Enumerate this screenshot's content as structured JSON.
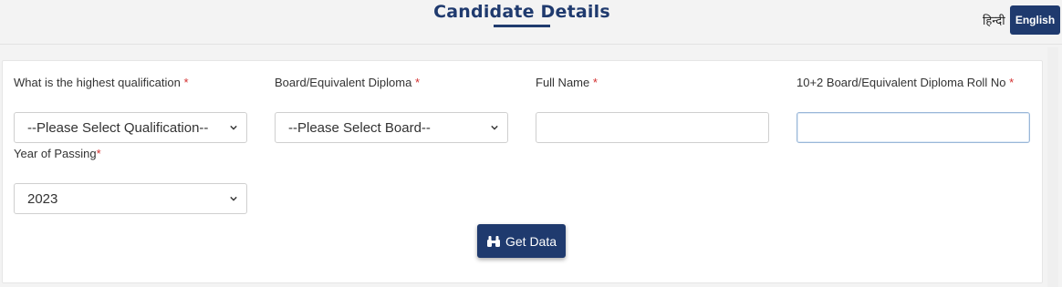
{
  "header": {
    "title": "Candidate Details",
    "lang_hindi": "हिन्दी",
    "lang_english": "English"
  },
  "form": {
    "qualification": {
      "label": "What is the highest qualification",
      "required_mark": "*",
      "value": "--Please Select Qualification--"
    },
    "board": {
      "label": "Board/Equivalent Diploma",
      "required_mark": "*",
      "value": "--Please Select Board--"
    },
    "full_name": {
      "label": "Full Name",
      "required_mark": "*",
      "value": ""
    },
    "roll_no": {
      "label": "10+2 Board/Equivalent Diploma Roll No",
      "required_mark": "*",
      "value": ""
    },
    "year": {
      "label": "Year of Passing",
      "required_mark": "*",
      "value": "2023"
    }
  },
  "actions": {
    "get_data_label": "Get Data",
    "get_data_icon": "binoculars-icon"
  },
  "colors": {
    "primary": "#1f3a6e",
    "required": "#d32f2f"
  }
}
